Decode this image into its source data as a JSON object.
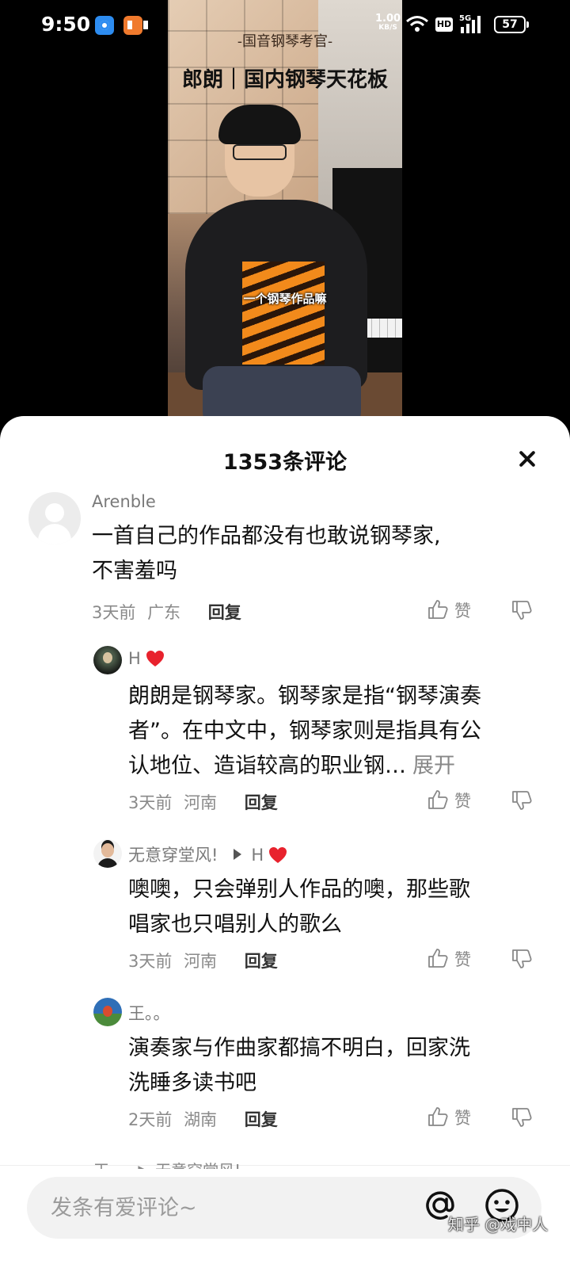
{
  "status_bar": {
    "time": "9:50",
    "net_speed": "1.00",
    "net_unit": "KB/S",
    "hd": "HD",
    "signal": "5G",
    "battery": "57",
    "icons": [
      "browser-app-icon",
      "reader-app-icon",
      "wifi-icon",
      "hd-icon",
      "signal-icon",
      "battery-icon"
    ]
  },
  "video": {
    "watermark": "-国音钢琴考官-",
    "title": "郎朗｜国内钢琴天花板",
    "subtitle": "一个钢琴作品嘛"
  },
  "comments_panel": {
    "title": "1353条评论",
    "close_icon": "close-icon",
    "comments": [
      {
        "user": "Arenble",
        "text": [
          "一首自己的作品都没有也敢说钢琴家,",
          "不害羞吗"
        ],
        "time": "3天前",
        "location": "广东",
        "reply_label": "回复",
        "like_label": "赞"
      },
      {
        "user": "H",
        "text": [
          "朗朗是钢琴家。钢琴家是指“钢琴演奏",
          "者”。在中文中，钢琴家则是指具有公",
          "认地位、造诣较高的职业钢…"
        ],
        "expand_label": "展开",
        "time": "3天前",
        "location": "河南",
        "reply_label": "回复",
        "like_label": "赞"
      },
      {
        "user": "无意穿堂风!",
        "reply_to": "H",
        "text": [
          "噢噢，只会弹别人作品的噢，那些歌",
          "唱家也只唱别人的歌么"
        ],
        "time": "3天前",
        "location": "河南",
        "reply_label": "回复",
        "like_label": "赞"
      },
      {
        "user": "王。。",
        "text": [
          "演奏家与作曲家都搞不明白，回家洗",
          "洗睡多读书吧"
        ],
        "time": "2天前",
        "location": "湖南",
        "reply_label": "回复",
        "like_label": "赞"
      }
    ],
    "peek_text": "王。。 ▶ 无意穿堂风!"
  },
  "input_bar": {
    "placeholder": "发条有爱评论~",
    "watermark": "知乎 @戏中人"
  },
  "colors": {
    "heart": "#e8222d",
    "text_primary": "#111111",
    "text_secondary": "#8a8a8a",
    "sheet_background": "#ffffff"
  }
}
